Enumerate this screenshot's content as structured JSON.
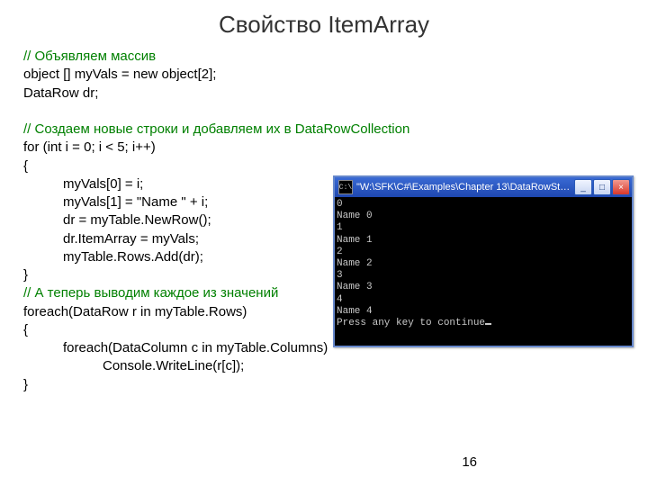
{
  "title": "Свойство ItemArray",
  "code": {
    "c1": "// Объявляем массив",
    "l1": "object [] myVals = new object[2];",
    "l2": "DataRow dr;",
    "blank1": "",
    "c2": "// Создаем новые строки и добавляем их в DataRowCollection",
    "l3": "for (int i = 0; i < 5; i++)",
    "l4": "{",
    "l5": "myVals[0] = i;",
    "l6": "myVals[1] = \"Name \" + i;",
    "l7": "dr = myTable.NewRow();",
    "l8": "dr.ItemArray = myVals;",
    "l9": "myTable.Rows.Add(dr);",
    "l10": "}",
    "c3": "// А теперь выводим каждое из значений",
    "l11": "foreach(DataRow r in myTable.Rows)",
    "l12": "{",
    "l13": "foreach(DataColumn c in myTable.Columns)",
    "l14": "Console.WriteLine(r[c]);",
    "l15": "}"
  },
  "page_number": "16",
  "console": {
    "icon_glyph": "C:\\",
    "title": "\"W:\\SFK\\C#\\Examples\\Chapter 13\\DataRowSta...",
    "buttons": {
      "min": "_",
      "max": "□",
      "close": "×"
    },
    "lines": [
      "0",
      "Name 0",
      "1",
      "Name 1",
      "2",
      "Name 2",
      "3",
      "Name 3",
      "4",
      "Name 4"
    ],
    "prompt": "Press any key to continue"
  }
}
